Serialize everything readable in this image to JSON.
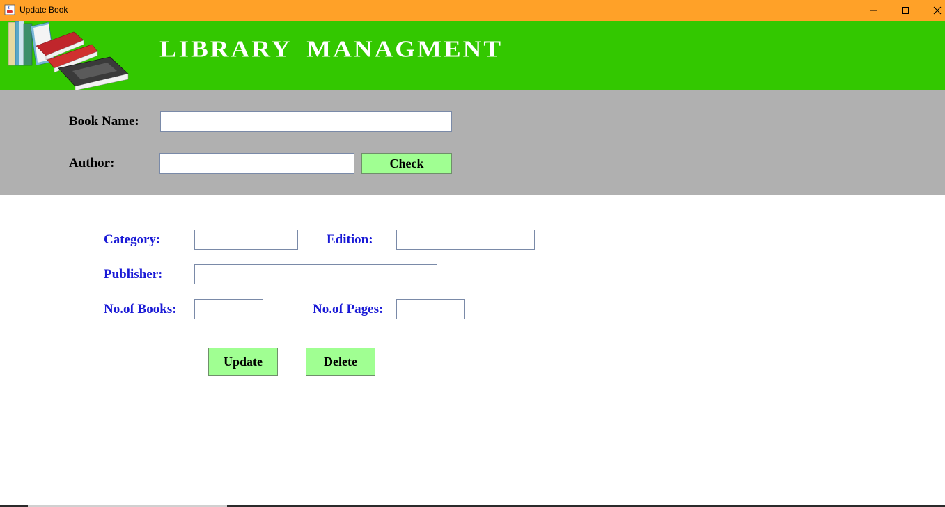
{
  "window": {
    "title": "Update Book",
    "icon": "java-cup-icon",
    "controls": {
      "minimize": "minimize-icon",
      "maximize": "maximize-icon",
      "close": "close-icon"
    }
  },
  "header": {
    "title": "LIBRARY MANAGMENT",
    "logo": "books-stack-icon"
  },
  "search": {
    "book_name_label": "Book Name:",
    "book_name_value": "",
    "author_label": "Author:",
    "author_value": "",
    "check_label": "Check"
  },
  "details": {
    "category_label": "Category:",
    "category_value": "",
    "edition_label": "Edition:",
    "edition_value": "",
    "publisher_label": "Publisher:",
    "publisher_value": "",
    "books_label": "No.of Books:",
    "books_value": "",
    "pages_label": "No.of Pages:",
    "pages_value": ""
  },
  "actions": {
    "update_label": "Update",
    "delete_label": "Delete"
  },
  "colors": {
    "titlebar": "#ffa128",
    "header": "#33c800",
    "search_panel": "#b0b0b0",
    "button": "#a0ff92",
    "label_blue": "#1a1ad6"
  }
}
